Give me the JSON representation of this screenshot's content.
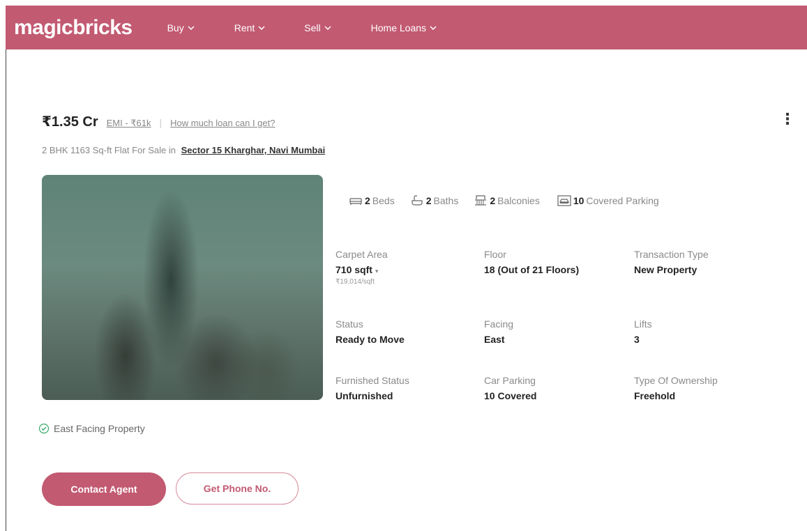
{
  "header": {
    "logo": "magicbricks",
    "nav": [
      {
        "label": "Buy"
      },
      {
        "label": "Rent"
      },
      {
        "label": "Sell"
      },
      {
        "label": "Home Loans"
      }
    ]
  },
  "listing": {
    "price": "₹1.35 Cr",
    "emi": "EMI - ₹61k",
    "separator": "|",
    "loan_link": "How much loan can I get?",
    "menu": "⋮",
    "subtitle": "2 BHK 1163 Sq-ft Flat For Sale in",
    "locality": "Sector 15 Kharghar, Navi Mumbai",
    "amenities": {
      "beds_num": "2",
      "beds_label": "Beds",
      "baths_num": "2",
      "baths_label": "Baths",
      "balconies_num": "2",
      "balconies_label": "Balconies",
      "parking_num": "10",
      "parking_label": "Covered Parking"
    },
    "details": {
      "carpet_area": {
        "label": "Carpet Area",
        "value": "710 sqft",
        "sub": "₹19,014/sqft"
      },
      "floor": {
        "label": "Floor",
        "value": "18 (Out of 21 Floors)"
      },
      "transaction_type": {
        "label": "Transaction Type",
        "value": "New Property"
      },
      "status": {
        "label": "Status",
        "value": "Ready to Move"
      },
      "facing": {
        "label": "Facing",
        "value": "East"
      },
      "lifts": {
        "label": "Lifts",
        "value": "3"
      },
      "furnished_status": {
        "label": "Furnished Status",
        "value": "Unfurnished"
      },
      "car_parking": {
        "label": "Car Parking",
        "value": "10 Covered"
      },
      "ownership": {
        "label": "Type Of Ownership",
        "value": "Freehold"
      }
    },
    "highlight": "East Facing Property",
    "contact_button": "Contact Agent",
    "phone_button": "Get Phone No."
  },
  "colors": {
    "brand": "#c25a72"
  }
}
